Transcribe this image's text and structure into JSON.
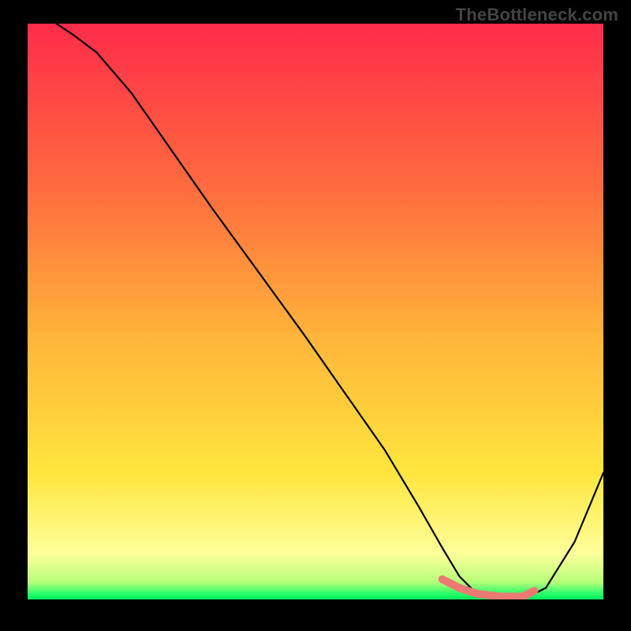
{
  "watermark": "TheBottleneck.com",
  "colors": {
    "gradient_stops": [
      {
        "offset": "0%",
        "color": "#ff2c4a"
      },
      {
        "offset": "28%",
        "color": "#ff6a3f"
      },
      {
        "offset": "55%",
        "color": "#ffb63a"
      },
      {
        "offset": "78%",
        "color": "#ffe63e"
      },
      {
        "offset": "92%",
        "color": "#ffff9a"
      },
      {
        "offset": "97%",
        "color": "#b6ff7a"
      },
      {
        "offset": "99%",
        "color": "#2bff6a"
      },
      {
        "offset": "100%",
        "color": "#00e85a"
      }
    ],
    "curve": "#000000",
    "marker": "#eb7a72",
    "frame": "#000000"
  },
  "chart_data": {
    "type": "line",
    "title": "",
    "xlabel": "",
    "ylabel": "",
    "xlim": [
      0,
      100
    ],
    "ylim": [
      0,
      100
    ],
    "grid": false,
    "legend": false,
    "series": [
      {
        "name": "bottleneck-curve",
        "x": [
          5,
          8,
          12,
          18,
          25,
          32,
          40,
          48,
          55,
          62,
          68,
          72,
          75,
          78,
          82,
          86,
          90,
          95,
          100
        ],
        "y": [
          100,
          98,
          95,
          88,
          78,
          68,
          57,
          46,
          36,
          26,
          16,
          9,
          4,
          1,
          0,
          0,
          2,
          10,
          22
        ]
      }
    ],
    "annotations": [
      {
        "name": "trough-marker",
        "x": [
          72,
          75,
          78,
          82,
          86,
          88
        ],
        "y": [
          3.5,
          2,
          1,
          0.5,
          0.5,
          1.5
        ]
      }
    ]
  }
}
